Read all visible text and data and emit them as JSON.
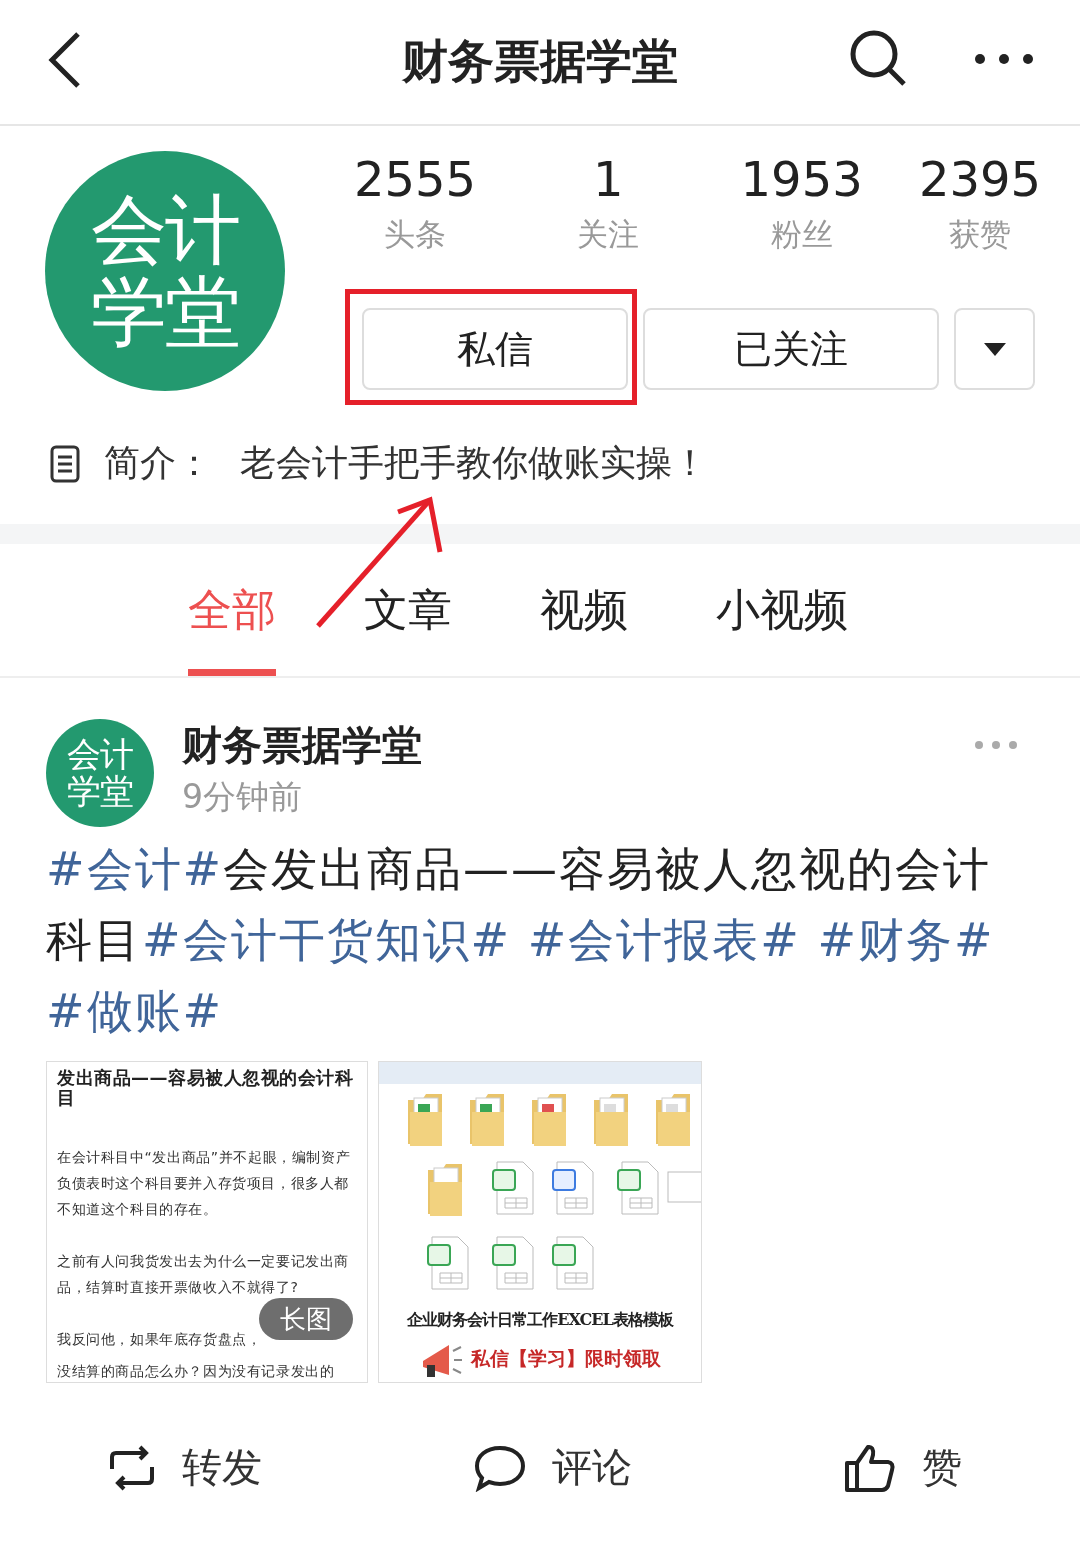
{
  "header": {
    "title": "财务票据学堂"
  },
  "profile": {
    "avatar_lines": [
      "会计",
      "学堂"
    ],
    "stats": [
      {
        "value": "2555",
        "label": "头条"
      },
      {
        "value": "1",
        "label": "关注"
      },
      {
        "value": "1953",
        "label": "粉丝"
      },
      {
        "value": "2395",
        "label": "获赞"
      }
    ],
    "buttons": [
      "私信",
      "已关注"
    ],
    "intro_label": "简介：",
    "intro": "老会计手把手教你做账实操！"
  },
  "tabs": [
    {
      "label": "全部",
      "selected": true
    },
    {
      "label": "文章",
      "selected": false
    },
    {
      "label": "视频",
      "selected": false
    },
    {
      "label": "小视频",
      "selected": false
    }
  ],
  "post": {
    "avatar_lines": [
      "会计",
      "学堂"
    ],
    "author": "财务票据学堂",
    "time": "9分钟前",
    "segments": [
      {
        "kind": "tag",
        "text": "#会计#"
      },
      {
        "kind": "plain",
        "text": "会发出商品——容易被人忽视的会计科目"
      },
      {
        "kind": "tag",
        "text": "#会计干货知识# #会计报表# #财务# #做账#"
      }
    ],
    "image_1": {
      "title": "发出商品——容易被人忽视的会计科目",
      "paragraphs": [
        "在会计科目中“发出商品”并不起眼，编制资产负债表时这个科目要并入存货项目，很多人都不知道这个科目的存在。",
        "之前有人问我货发出去为什么一定要记发出商品，结算时直接开票做收入不就得了?",
        "我反问他，如果年底存货盘点，",
        "没结算的商品怎么办？因为没有记录发出的"
      ],
      "badge": "长图"
    },
    "image_2": {
      "headline": "企业财务会计日常工作EXCEL表格模板",
      "promo": "私信【学习】限时领取"
    },
    "actions": [
      "转发",
      "评论",
      "赞"
    ]
  }
}
